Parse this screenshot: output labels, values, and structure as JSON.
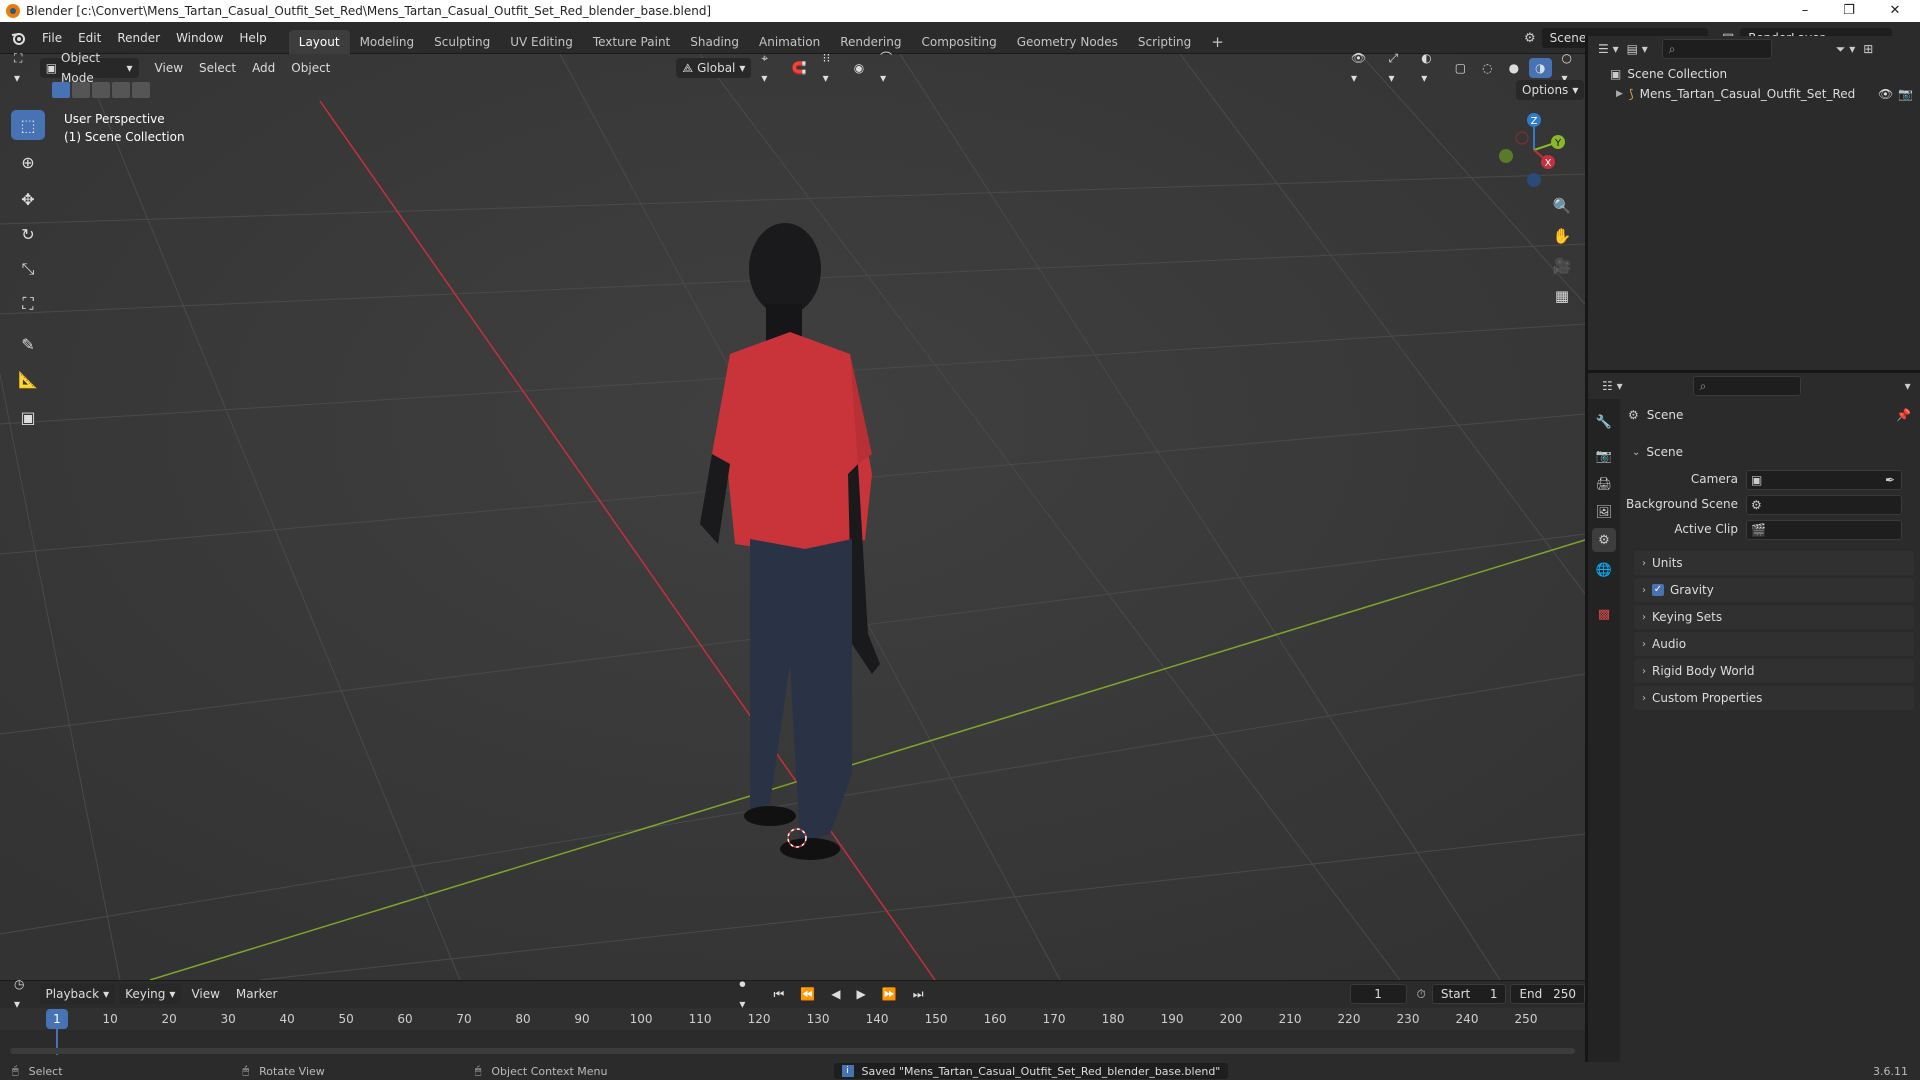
{
  "window": {
    "title": "Blender [c:\\Convert\\Mens_Tartan_Casual_Outfit_Set_Red\\Mens_Tartan_Casual_Outfit_Set_Red_blender_base.blend]",
    "min": "–",
    "max": "❐",
    "close": "✕"
  },
  "menu": [
    "File",
    "Edit",
    "Render",
    "Window",
    "Help"
  ],
  "workspaces": [
    "Layout",
    "Modeling",
    "Sculpting",
    "UV Editing",
    "Texture Paint",
    "Shading",
    "Animation",
    "Rendering",
    "Compositing",
    "Geometry Nodes",
    "Scripting"
  ],
  "workspace_add": "+",
  "active_workspace": "Layout",
  "scene_name": "Scene",
  "render_layer": "RenderLayer",
  "viewport": {
    "mode": "Object Mode",
    "menus": [
      "View",
      "Select",
      "Add",
      "Object"
    ],
    "orientation": "Global",
    "options": "Options",
    "perspective": "User Perspective",
    "collection": "(1) Scene Collection",
    "axis_x": "X",
    "axis_y": "Y",
    "axis_z": "Z"
  },
  "outliner": {
    "root": "Scene Collection",
    "item": "Mens_Tartan_Casual_Outfit_Set_Red"
  },
  "properties": {
    "context": "Scene",
    "section": "Scene",
    "camera_label": "Camera",
    "background_label": "Background Scene",
    "clip_label": "Active Clip",
    "panels": [
      "Units",
      "Gravity",
      "Keying Sets",
      "Audio",
      "Rigid Body World",
      "Custom Properties"
    ],
    "gravity_checked": true
  },
  "timeline": {
    "menus": [
      "Playback",
      "Keying",
      "View",
      "Marker"
    ],
    "current_frame": "1",
    "start_label": "Start",
    "start": "1",
    "end_label": "End",
    "end": "250",
    "ticks": [
      "1",
      "10",
      "20",
      "30",
      "40",
      "50",
      "60",
      "70",
      "80",
      "90",
      "100",
      "110",
      "120",
      "130",
      "140",
      "150",
      "160",
      "170",
      "180",
      "190",
      "200",
      "210",
      "220",
      "230",
      "240",
      "250"
    ]
  },
  "status": {
    "select": "Select",
    "rotate": "Rotate View",
    "context_menu": "Object Context Menu",
    "message": "Saved \"Mens_Tartan_Casual_Outfit_Set_Red_blender_base.blend\"",
    "version": "3.6.11"
  },
  "colors": {
    "accent": "#4772b3",
    "x_axis": "#c5303c",
    "y_axis": "#8ab827",
    "z_axis": "#2f7ccb",
    "shirt": "#c8343a"
  }
}
